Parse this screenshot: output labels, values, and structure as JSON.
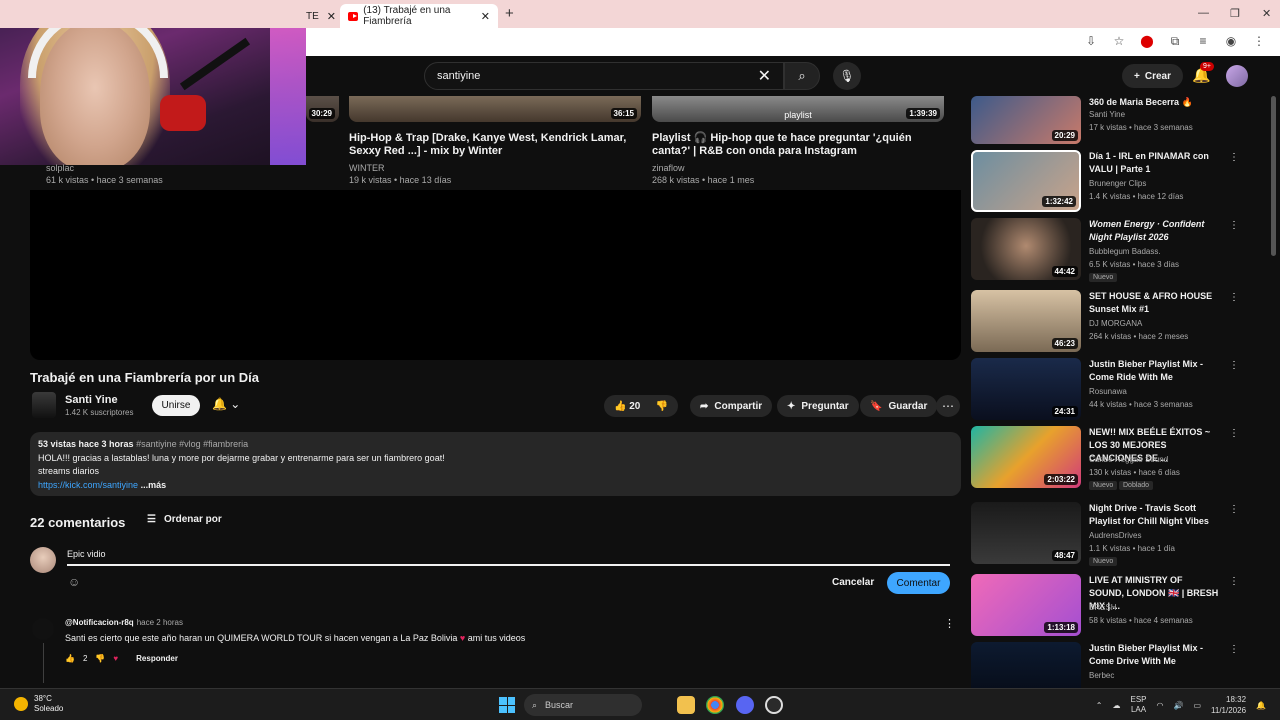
{
  "browser": {
    "tab_active_label": "(13) Trabajé en una Fiambrería",
    "tab_left_label": "ТЕ",
    "new_tab_symbol": "+"
  },
  "header": {
    "search_value": "santiyine",
    "create_label": "Crear",
    "notif_badge": "9+"
  },
  "top_videos": [
    {
      "duration": "30:29",
      "title": "",
      "channel": "solplac",
      "meta": "61 k vistas • hace 3 semanas"
    },
    {
      "duration": "36:15",
      "title": "Hip-Hop & Trap [Drake, Kanye West, Kendrick Lamar, Sexxy Red ...] - mix by Winter",
      "channel": "WINTER",
      "meta": "19 k vistas • hace 13 días"
    },
    {
      "duration": "1:39:39",
      "overlay": "playlist",
      "title": "Playlist 🎧 Hip-hop que te hace preguntar '¿quién canta?' | R&B con onda para Instagram",
      "channel": "zinaflow",
      "meta": "268 k vistas • hace 1 mes"
    }
  ],
  "video": {
    "title": "Trabajé en una Fiambrería por un Día",
    "channel": "Santi Yine",
    "subscribers": "1.42 K suscriptores",
    "join_label": "Unirse",
    "likes": "20",
    "share_label": "Compartir",
    "ask_label": "Preguntar",
    "save_label": "Guardar",
    "views_time": "53 vistas  hace 3 horas",
    "hashtags": "#santiyine #vlog #fiambreria",
    "desc_line1": "HOLA!!! gracias a lastablas! luna y more por dejarme grabar y entrenarme para ser un fiambrero goat!",
    "desc_line2": "streams diarios",
    "desc_link": "https://kick.com/santiyine",
    "desc_more": "...más"
  },
  "comments": {
    "count_label": "22 comentarios",
    "sort_label": "Ordenar por",
    "input_value": "Epic vidio",
    "cancel_label": "Cancelar",
    "submit_label": "Comentar",
    "first": {
      "user": "@Notificacion-r8q",
      "time": "hace 2 horas",
      "text": "Santi es cierto que este año haran un QUIMERA WORLD TOUR si hacen vengan a La Paz Bolivia",
      "text_tail": "ami tus videos",
      "likes": "2",
      "reply_label": "Responder"
    }
  },
  "sidebar": [
    {
      "title": "360 de Maria Becerra 🔥",
      "channel": "Santi Yine",
      "meta": "17 k vistas • hace 3 semanas",
      "duration": "20:29",
      "tag": ""
    },
    {
      "title": "Día 1 - IRL en PINAMAR con VALU | Parte 1",
      "channel": "Brunenger Clips",
      "meta": "1.4 K vistas • hace 12 días",
      "duration": "1:32:42",
      "tag": ""
    },
    {
      "title": "Women Energy · Confident Night Playlist 2026",
      "channel": "Bubblegum Badass.",
      "meta": "6.5 K vistas • hace 3 días",
      "duration": "44:42",
      "tag": "Nuevo"
    },
    {
      "title": "SET HOUSE & AFRO HOUSE Sunset Mix #1",
      "channel": "DJ MORGANA",
      "meta": "264 k vistas • hace 2 meses",
      "duration": "46:23",
      "tag": ""
    },
    {
      "title": "Justin Bieber Playlist Mix - Come Ride With Me",
      "channel": "Rosunawa",
      "meta": "44 k vistas • hace 3 semanas",
      "duration": "24:31",
      "tag": ""
    },
    {
      "title": "NEW!! MIX BEÉLE ÉXITOS ~ LOS 30 MEJORES CANCIONES DE ...",
      "channel": "Caribe Reggae Sound",
      "meta": "130 k vistas • hace 6 días",
      "duration": "2:03:22",
      "tag": "Nuevo",
      "tag2": "Doblado"
    },
    {
      "title": "Night Drive - Travis Scott Playlist for Chill Night Vibes",
      "channel": "AudrensDrives",
      "meta": "1.1 K vistas • hace 1 día",
      "duration": "48:47",
      "tag": "Nuevo"
    },
    {
      "title": "LIVE AT MINISTRY OF SOUND, LONDON 🇬🇧 | BRESH MIX | ...",
      "channel": "BRESH",
      "meta": "58 k vistas • hace 4 semanas",
      "duration": "1:13:18",
      "tag": ""
    },
    {
      "title": "Justin Bieber Playlist Mix - Come Drive With Me",
      "channel": "Berbec",
      "meta": "",
      "duration": "",
      "tag": ""
    }
  ],
  "taskbar": {
    "temp": "38°C",
    "weather": "Soleado",
    "search_label": "Buscar",
    "lang": "ESP",
    "lang2": "LAA",
    "time": "18:32",
    "date": "11/1/2026"
  },
  "colors": {
    "accent": "#3ea6ff",
    "bg": "#0f0f0f",
    "chip": "#272727",
    "brand": "#ff0000"
  }
}
